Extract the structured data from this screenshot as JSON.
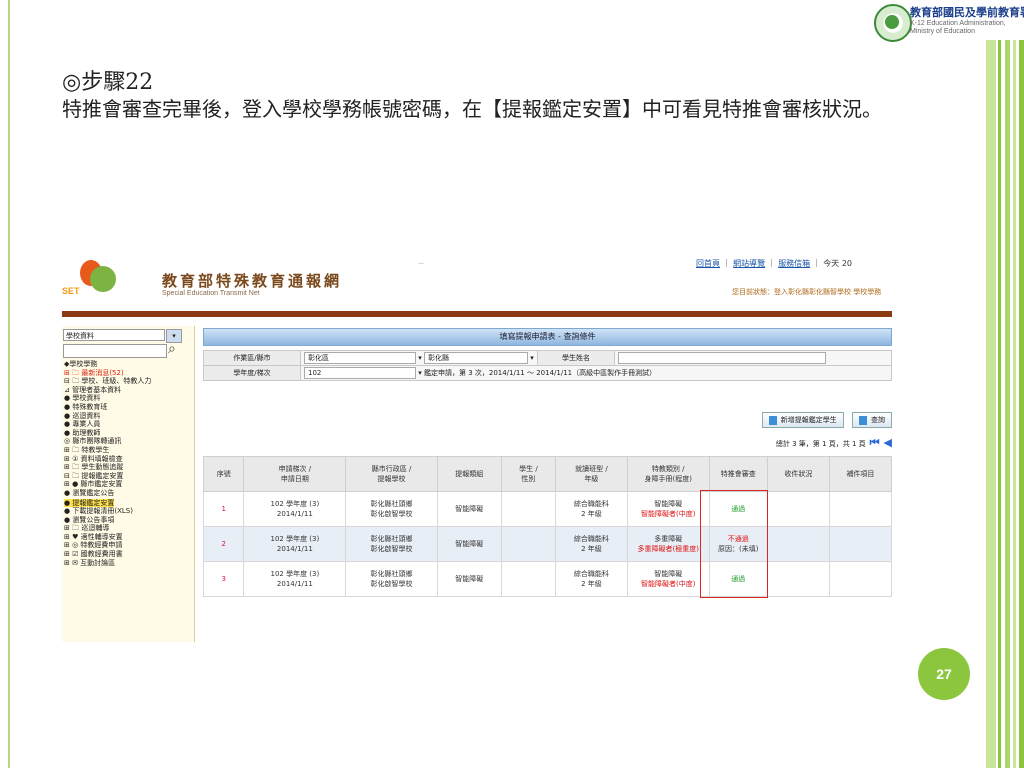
{
  "slide": {
    "step": "◎步驟22",
    "body": "特推會審查完畢後，登入學校學務帳號密碼，在【提報鑑定安置】中可看見特推會審核狀況。",
    "page_number": "27",
    "logo_line1": "教育部國民及學前教育署",
    "logo_line2": "K-12 Education Administration,",
    "logo_line3": "Ministry of Education"
  },
  "site": {
    "logo_text": "SET",
    "title": "教育部特殊教育通報網",
    "subtitle": "Special Education Transmit Net",
    "dots": "...",
    "links": [
      "回首頁",
      "網站導覽",
      "服務信箱"
    ],
    "today": "今天 20",
    "user_status": "您目前狀態：登入彰化縣彰化縣智學校 學校學務"
  },
  "sidebar": {
    "select_value": "學校資料",
    "items": [
      {
        "label": "◆學校學務",
        "red": false
      },
      {
        "label": "⊞ 🗀 最新消息(52)",
        "red": true
      },
      {
        "label": "⊟ 🗀 學校、班級、特教人力",
        "red": false
      },
      {
        "label": "    ⊿ 管理者基本資料",
        "red": false
      },
      {
        "label": "    ● 學校資料",
        "red": false
      },
      {
        "label": "    ● 特殊教育班",
        "red": false
      },
      {
        "label": "    ● 巡迴資料",
        "red": false
      },
      {
        "label": "    ● 專業人員",
        "red": false
      },
      {
        "label": "    ● 助理教師",
        "red": false
      },
      {
        "label": "    ◎ 縣市團隊轉通訊",
        "red": false
      },
      {
        "label": "⊞ 🗀 特教學生",
        "red": false
      },
      {
        "label": "⊞ ① 資料填報檢查",
        "red": false
      },
      {
        "label": "⊞ 🗀 學生動態追蹤",
        "red": false
      },
      {
        "label": "⊟ 🗀 提報鑑定安置",
        "red": false
      },
      {
        "label": "  ⊞ ● 縣市鑑定安置",
        "red": false
      },
      {
        "label": "    ● 瀏覽鑑定公告",
        "red": false
      },
      {
        "label": "    ● 提報鑑定安置",
        "red": false,
        "highlight": true
      },
      {
        "label": "    ● 下載提報清冊(XLS)",
        "red": false
      },
      {
        "label": "    ● 瀏覽公告事項",
        "red": false
      },
      {
        "label": "⊞ 🗀 巡迴輔導",
        "red": false
      },
      {
        "label": "⊞ ♥ 適性輔導安置",
        "red": false
      },
      {
        "label": "⊞ ◎ 特教經費申請",
        "red": false
      },
      {
        "label": "⊞ ☑ 國教經費用書",
        "red": false
      },
      {
        "label": "⊞ ✉ 互動討論區",
        "red": false
      }
    ]
  },
  "panel": {
    "title": "填寫提報申請表 - 查詢條件",
    "filters": {
      "region_label": "作業區/縣市",
      "region_value": "彰化區",
      "county_value": "彰化縣",
      "name_label": "學生姓名",
      "term_label": "學年度/梯次",
      "term_value": "102",
      "term_detail": "鑑定申請，第 3 次，2014/1/11 ～ 2014/1/11（高級中區製作手冊測試）"
    },
    "buttons": [
      "新增提報鑑定學生",
      "查詢"
    ],
    "count_text": "總計 3 筆，第 1 頁，共 1 頁",
    "headers": [
      "序號",
      "申請梯次 / 申請日期",
      "縣市行政區 / 提報學校",
      "提報類組",
      "學生 / 性別",
      "就讀班型 / 年級",
      "特教類別 / 身障手冊(程度)",
      "特推會審查",
      "收件狀況",
      "補件項目"
    ],
    "rows": [
      {
        "no": "1",
        "apply": "102 學年度 (3)",
        "date": "2014/1/11",
        "area": "彰化縣社頭鄉",
        "school": "彰化啟智學校",
        "group": "智能障礙",
        "student": "",
        "class": "綜合職能科",
        "grade": "2 年級",
        "type": "智能障礙",
        "handbook": "智能障礙者(中度)",
        "review": "通過",
        "review2": "",
        "status": "",
        "items": ""
      },
      {
        "no": "2",
        "apply": "102 學年度 (3)",
        "date": "2014/1/11",
        "area": "彰化縣社頭鄉",
        "school": "彰化啟智學校",
        "group": "智能障礙",
        "student": "",
        "class": "綜合職能科",
        "grade": "2 年級",
        "type": "多重障礙",
        "handbook": "多重障礙者(極重度)",
        "review": "不通過",
        "review2": "原因：(未填)",
        "status": "",
        "items": ""
      },
      {
        "no": "3",
        "apply": "102 學年度 (3)",
        "date": "2014/1/11",
        "area": "彰化縣社頭鄉",
        "school": "彰化啟智學校",
        "group": "智能障礙",
        "student": "",
        "class": "綜合職能科",
        "grade": "2 年級",
        "type": "智能障礙",
        "handbook": "智能障礙者(中度)",
        "review": "通過",
        "review2": "",
        "status": "",
        "items": ""
      }
    ]
  },
  "colors": {
    "accent_green": "#8cc63f",
    "brown_bar": "#8b3a12",
    "highlight_box": "#dd2222"
  }
}
